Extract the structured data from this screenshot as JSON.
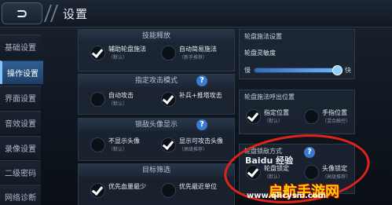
{
  "header": {
    "back_symbol": "⊃",
    "title": "设置"
  },
  "sidebar": {
    "items": [
      {
        "label": "基础设置"
      },
      {
        "label": "操作设置"
      },
      {
        "label": "界面设置"
      },
      {
        "label": "音效设置"
      },
      {
        "label": "录像设置"
      },
      {
        "label": "二级密码"
      },
      {
        "label": "网络诊断"
      }
    ],
    "active_index": 1
  },
  "skill_cast": {
    "title": "技能释放",
    "options": [
      {
        "label": "辅助轮盘施法",
        "sub": "（默认）",
        "checked": true
      },
      {
        "label": "自动简易施法",
        "sub": "（新手推荐）",
        "checked": false
      }
    ]
  },
  "attack_mode": {
    "title": "指定攻击模式",
    "options": [
      {
        "label": "自动攻击",
        "sub": "（默认）",
        "checked": false
      },
      {
        "label": "补兵+推塔攻击",
        "sub": "",
        "checked": true
      }
    ]
  },
  "lock_avatar": {
    "title": "锁敌头像显示",
    "options": [
      {
        "label": "不显示头像",
        "sub": "（默认）",
        "checked": false
      },
      {
        "label": "显示可攻击头像",
        "sub": "（高级推荐）",
        "checked": true
      }
    ]
  },
  "target_filter": {
    "title": "目标筛选",
    "options": [
      {
        "label": "优先血量最少",
        "sub": "",
        "checked": true
      },
      {
        "label": "优先最近单位",
        "sub": "",
        "checked": false
      }
    ]
  },
  "wheel_cast": {
    "title": "轮盘施法设置",
    "sensitivity_label": "轮盘灵敏度",
    "slow": "慢",
    "fast": "快",
    "sensitivity_level": 0.95
  },
  "wheel_call": {
    "title": "轮盘施法呼出位置",
    "options": [
      {
        "label": "指定位置",
        "sub": "（默认）",
        "checked": true
      },
      {
        "label": "手指位置",
        "sub": "（混合触控）",
        "checked": false
      }
    ]
  },
  "wheel_lock": {
    "title": "轮盘锁敌方式",
    "options": [
      {
        "label": "轮盘锁定",
        "sub": "（默认）",
        "checked": true
      },
      {
        "label": "头像锁定",
        "sub": "（高级推荐）",
        "checked": false
      }
    ]
  },
  "watermark": {
    "line1": "Baidu 经验",
    "line2": "启航手游网",
    "line3": "www.qhcysm.com"
  },
  "colors": {
    "accent": "#3a7ad0",
    "annotation": "#e2231a"
  }
}
